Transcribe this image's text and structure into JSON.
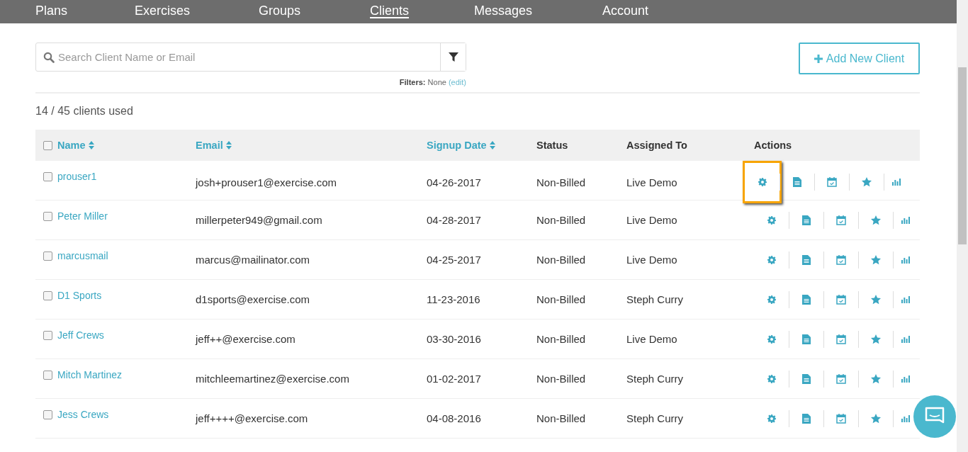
{
  "nav": [
    {
      "label": "Plans",
      "selected": false
    },
    {
      "label": "Exercises",
      "selected": false
    },
    {
      "label": "Groups",
      "selected": false
    },
    {
      "label": "Clients",
      "selected": true
    },
    {
      "label": "Messages",
      "selected": false
    },
    {
      "label": "Account",
      "selected": false
    }
  ],
  "search": {
    "placeholder": "Search Client Name or Email"
  },
  "filters": {
    "label": "Filters:",
    "value": "None",
    "edit": "(edit)"
  },
  "add_button": "Add New Client",
  "usage": "14 / 45 clients used",
  "table": {
    "columns": [
      {
        "label": "Name",
        "sortable": true
      },
      {
        "label": "Email",
        "sortable": true
      },
      {
        "label": "Signup Date",
        "sortable": true
      },
      {
        "label": "Status",
        "sortable": false
      },
      {
        "label": "Assigned To",
        "sortable": false
      },
      {
        "label": "Actions",
        "sortable": false
      }
    ],
    "rows": [
      {
        "name": "prouser1",
        "email": "josh+prouser1@exercise.com",
        "signup": "04-26-2017",
        "status": "Non-Billed",
        "assigned": "Live Demo",
        "checked": false,
        "highlighted": true
      },
      {
        "name": "Peter Miller",
        "email": "millerpeter949@gmail.com",
        "signup": "04-28-2017",
        "status": "Non-Billed",
        "assigned": "Live Demo",
        "checked": false,
        "highlighted": false
      },
      {
        "name": "marcusmail",
        "email": "marcus@mailinator.com",
        "signup": "04-25-2017",
        "status": "Non-Billed",
        "assigned": "Live Demo",
        "checked": false,
        "highlighted": false
      },
      {
        "name": "D1 Sports",
        "email": "d1sports@exercise.com",
        "signup": "11-23-2016",
        "status": "Non-Billed",
        "assigned": "Steph Curry",
        "checked": false,
        "highlighted": false
      },
      {
        "name": "Jeff Crews",
        "email": "jeff++@exercise.com",
        "signup": "03-30-2016",
        "status": "Non-Billed",
        "assigned": "Live Demo",
        "checked": false,
        "highlighted": false
      },
      {
        "name": "Mitch Martinez",
        "email": "mitchleemartinez@exercise.com",
        "signup": "01-02-2017",
        "status": "Non-Billed",
        "assigned": "Steph Curry",
        "checked": false,
        "highlighted": false
      },
      {
        "name": "Jess Crews",
        "email": "jeff++++@exercise.com",
        "signup": "04-08-2016",
        "status": "Non-Billed",
        "assigned": "Steph Curry",
        "checked": false,
        "highlighted": false
      }
    ],
    "all_checked": false
  }
}
